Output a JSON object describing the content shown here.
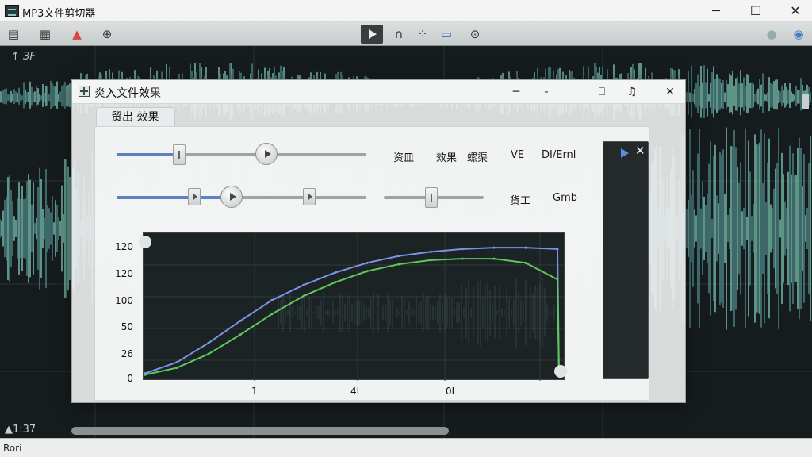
{
  "window": {
    "title": "MP3文件剪切器",
    "minimize": "─",
    "maximize": "☐",
    "close": "✕"
  },
  "toolbar": {
    "icons": [
      "file-icon",
      "film-icon",
      "colorful-app-icon",
      "search-zoom-icon",
      "play-icon",
      "headphones-icon",
      "cursor-icon",
      "screen-icon",
      "forward-icon",
      "record-icon",
      "settings-icon"
    ]
  },
  "waveform": {
    "ruler_label": "↑ ЗF",
    "time_label": "▲1:37",
    "colors": {
      "bright": "#7ec9b3",
      "dim": "#4f8a8c"
    }
  },
  "status": {
    "text": "Rori"
  },
  "dialog": {
    "title": "炎入文件效果",
    "tab_label": "贸出 效果",
    "controls": {
      "minimize": "─",
      "dash": "-",
      "restore": "⎕",
      "note": "♫",
      "close": "✕"
    },
    "slider1": {
      "value": 0.25,
      "thumb2": 0.6
    },
    "slider2": {
      "value": 0.46,
      "marker_a": 0.31,
      "marker_b": 0.77
    },
    "slider3": {
      "value": 0.48
    },
    "labels_row1": [
      "资皿",
      "效果",
      "螺渠",
      "VE",
      "DI/Ernl"
    ],
    "labels_row2": [
      "货工",
      "Gmb"
    ],
    "side_panel": {
      "close": "✕"
    }
  },
  "chart_data": {
    "type": "line",
    "y_ticks": [
      "120",
      "120",
      "100",
      "50",
      "26",
      "0"
    ],
    "x_ticks": [
      "1",
      "4I",
      "0I"
    ],
    "series": [
      {
        "color": "#7a92e8",
        "values": [
          2,
          10,
          24,
          40,
          55,
          66,
          75,
          82,
          87,
          90,
          92,
          93,
          93,
          92
        ]
      },
      {
        "color": "#5fc85a",
        "values": [
          1,
          6,
          16,
          30,
          45,
          58,
          68,
          76,
          81,
          84,
          85,
          85,
          82,
          70
        ]
      }
    ]
  }
}
